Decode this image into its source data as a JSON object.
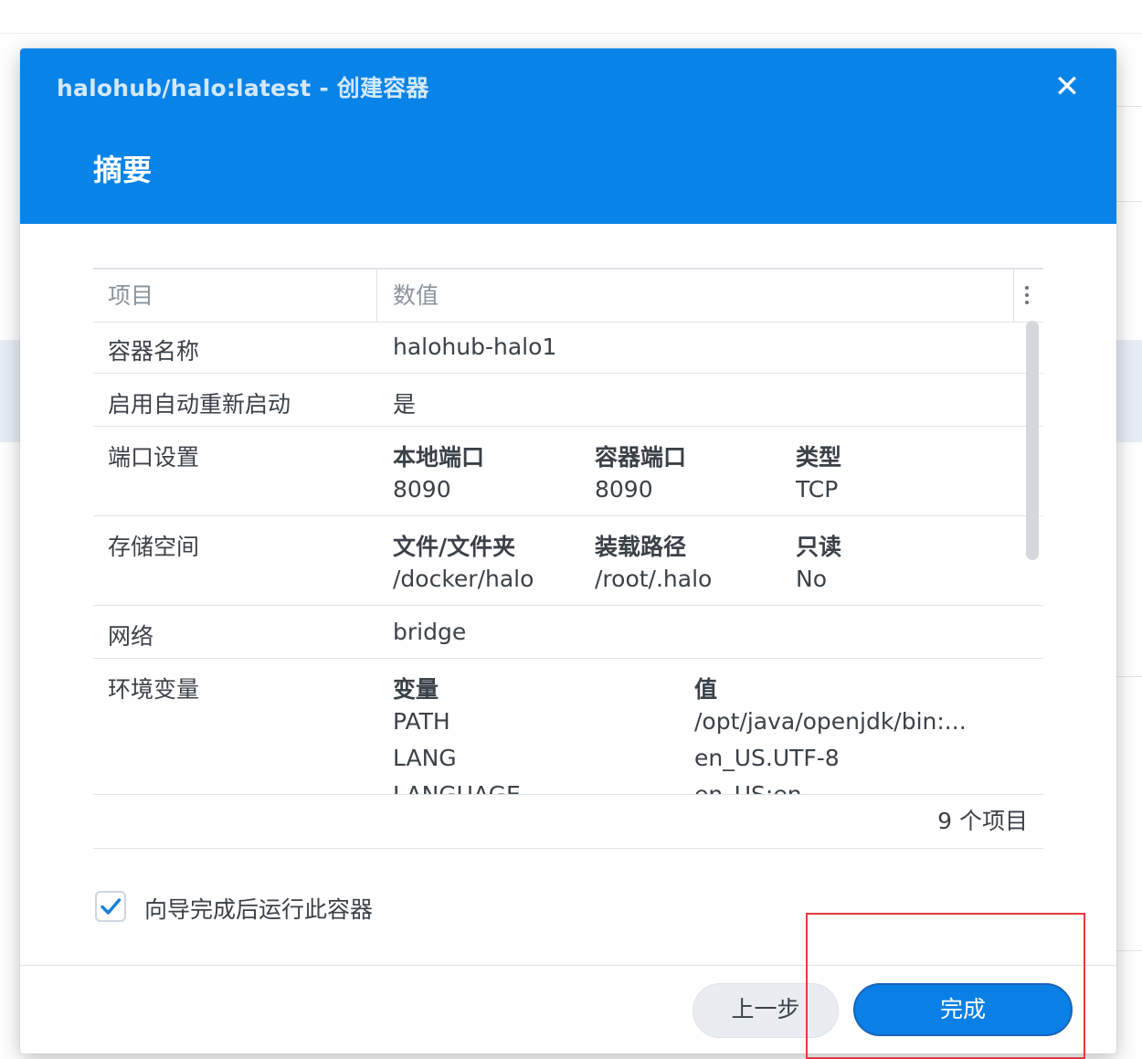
{
  "dialog": {
    "title": "halohub/halo:latest - 创建容器",
    "close_glyph": "✕",
    "step_title": "摘要"
  },
  "table": {
    "columns": [
      "项目",
      "数值"
    ],
    "rows": {
      "container_name": {
        "label": "容器名称",
        "value": "halohub-halo1"
      },
      "auto_restart": {
        "label": "启用自动重新启动",
        "value": "是"
      },
      "ports": {
        "label": "端口设置",
        "headers": [
          "本地端口",
          "容器端口",
          "类型"
        ],
        "values": [
          "8090",
          "8090",
          "TCP"
        ]
      },
      "storage": {
        "label": "存储空间",
        "headers": [
          "文件/文件夹",
          "装载路径",
          "只读"
        ],
        "values": [
          "/docker/halo",
          "/root/.halo",
          "No"
        ]
      },
      "network": {
        "label": "网络",
        "value": "bridge"
      },
      "env": {
        "label": "环境变量",
        "headers": [
          "变量",
          "值"
        ],
        "vars": [
          {
            "name": "PATH",
            "value": "/opt/java/openjdk/bin:..."
          },
          {
            "name": "LANG",
            "value": "en_US.UTF-8"
          },
          {
            "name": "LANGUAGE",
            "value": "en_US:en"
          }
        ]
      }
    },
    "footer_count": "9 个项目"
  },
  "run_after_wizard": {
    "label": "向导完成后运行此容器",
    "checked": true
  },
  "buttons": {
    "prev": "上一步",
    "finish": "完成"
  },
  "colors": {
    "header_blue": "#0883e8",
    "primary_button": "#0a7fe6",
    "highlight_box": "#e23b3b",
    "check_blue": "#1a7fd8"
  },
  "icons": [
    "close-icon",
    "more-options-icon",
    "checkmark-icon"
  ]
}
